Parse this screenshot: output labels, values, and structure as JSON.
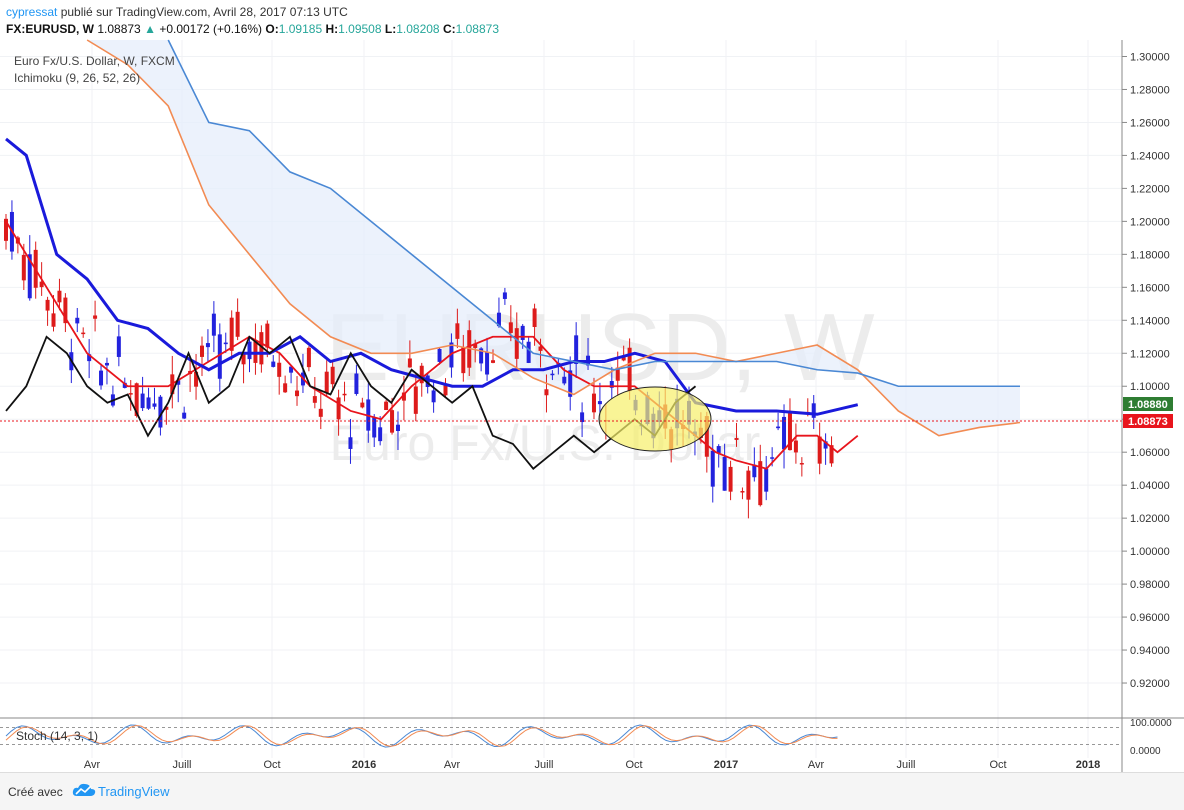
{
  "header": {
    "user": "cypressat",
    "published_text": "publié sur TradingView.com, Avril 28, 2017 07:13 UTC",
    "symbol": "FX:EURUSD, W",
    "price": "1.08873",
    "change": "+0.00172 (+0.16%)",
    "o_label": "O:",
    "o_value": "1.09185",
    "h_label": "H:",
    "h_value": "1.09508",
    "l_label": "L:",
    "l_value": "1.08208",
    "c_label": "C:",
    "c_value": "1.08873"
  },
  "legend": {
    "title": "Euro Fx/U.S. Dollar, W, FXCM",
    "indicator": "Ichimoku (9, 26, 52, 26)",
    "stoch": "Stoch (14, 3, 1)"
  },
  "watermark": {
    "line1": "EURUSD, W",
    "line2": "Euro Fx/U.S. Dollar"
  },
  "footer": {
    "created_with": "Créé avec",
    "brand": "TradingView"
  },
  "colors": {
    "tenkan": "#e8141c",
    "kijun": "#1a1adb",
    "chikou": "#111111",
    "senkou_a": "#f28b53",
    "senkou_b": "#4a88d4",
    "cloud": "#e6eefb",
    "up_candle": "#2222dd",
    "down_candle": "#dd1b1b",
    "price_tag": "#e8141c",
    "kijun_tag": "#2e7d32"
  },
  "chart_data": {
    "type": "candlestick",
    "y_axis": {
      "range": [
        0.9,
        1.31
      ],
      "ticks": [
        "1.30000",
        "1.28000",
        "1.26000",
        "1.24000",
        "1.22000",
        "1.20000",
        "1.18000",
        "1.16000",
        "1.14000",
        "1.12000",
        "1.10000",
        "1.08000",
        "1.06000",
        "1.04000",
        "1.02000",
        "1.00000",
        "0.98000",
        "0.96000",
        "0.94000",
        "0.92000"
      ]
    },
    "x_axis": {
      "labels": [
        "Avr",
        "Juill",
        "Oct",
        "2016",
        "Avr",
        "Juill",
        "Oct",
        "2017",
        "Avr",
        "Juill",
        "Oct",
        "2018"
      ]
    },
    "last_price": "1.08873",
    "kijun_value": "1.08880",
    "annotations": [
      "yellow ellipse around Oct 2016 cloud crossing"
    ],
    "series": [
      {
        "name": "Tenkan",
        "points": [
          [
            0,
            1.2
          ],
          [
            0.04,
            1.16
          ],
          [
            0.08,
            1.12
          ],
          [
            0.12,
            1.1
          ],
          [
            0.16,
            1.1
          ],
          [
            0.2,
            1.115
          ],
          [
            0.24,
            1.13
          ],
          [
            0.27,
            1.12
          ],
          [
            0.3,
            1.1
          ],
          [
            0.34,
            1.085
          ],
          [
            0.37,
            1.08
          ],
          [
            0.4,
            1.1
          ],
          [
            0.44,
            1.12
          ],
          [
            0.48,
            1.13
          ],
          [
            0.52,
            1.13
          ],
          [
            0.55,
            1.11
          ],
          [
            0.58,
            1.1
          ],
          [
            0.6,
            1.1
          ],
          [
            0.62,
            1.1
          ],
          [
            0.64,
            1.09
          ],
          [
            0.67,
            1.075
          ],
          [
            0.7,
            1.06
          ],
          [
            0.72,
            1.055
          ],
          [
            0.75,
            1.05
          ],
          [
            0.78,
            1.07
          ],
          [
            0.8,
            1.07
          ],
          [
            0.82,
            1.06
          ],
          [
            0.84,
            1.07
          ]
        ]
      },
      {
        "name": "Kijun",
        "points": [
          [
            0,
            1.25
          ],
          [
            0.02,
            1.24
          ],
          [
            0.05,
            1.18
          ],
          [
            0.08,
            1.165
          ],
          [
            0.11,
            1.14
          ],
          [
            0.14,
            1.135
          ],
          [
            0.17,
            1.12
          ],
          [
            0.2,
            1.11
          ],
          [
            0.23,
            1.12
          ],
          [
            0.26,
            1.12
          ],
          [
            0.29,
            1.13
          ],
          [
            0.32,
            1.115
          ],
          [
            0.35,
            1.12
          ],
          [
            0.38,
            1.11
          ],
          [
            0.41,
            1.105
          ],
          [
            0.44,
            1.1
          ],
          [
            0.47,
            1.1
          ],
          [
            0.5,
            1.11
          ],
          [
            0.53,
            1.11
          ],
          [
            0.56,
            1.115
          ],
          [
            0.59,
            1.115
          ],
          [
            0.62,
            1.12
          ],
          [
            0.65,
            1.115
          ],
          [
            0.68,
            1.09
          ],
          [
            0.72,
            1.085
          ],
          [
            0.76,
            1.085
          ],
          [
            0.8,
            1.083
          ],
          [
            0.84,
            1.0888
          ]
        ]
      },
      {
        "name": "Chikou",
        "points": [
          [
            0,
            1.085
          ],
          [
            0.02,
            1.1
          ],
          [
            0.04,
            1.13
          ],
          [
            0.06,
            1.12
          ],
          [
            0.08,
            1.1
          ],
          [
            0.1,
            1.09
          ],
          [
            0.12,
            1.095
          ],
          [
            0.14,
            1.07
          ],
          [
            0.16,
            1.09
          ],
          [
            0.18,
            1.12
          ],
          [
            0.2,
            1.09
          ],
          [
            0.22,
            1.1
          ],
          [
            0.24,
            1.13
          ],
          [
            0.26,
            1.12
          ],
          [
            0.28,
            1.13
          ],
          [
            0.3,
            1.1
          ],
          [
            0.32,
            1.095
          ],
          [
            0.34,
            1.12
          ],
          [
            0.36,
            1.1
          ],
          [
            0.38,
            1.09
          ],
          [
            0.4,
            1.11
          ],
          [
            0.42,
            1.1
          ],
          [
            0.44,
            1.09
          ],
          [
            0.46,
            1.1
          ],
          [
            0.48,
            1.07
          ],
          [
            0.5,
            1.065
          ],
          [
            0.52,
            1.05
          ],
          [
            0.54,
            1.06
          ],
          [
            0.56,
            1.07
          ],
          [
            0.58,
            1.06
          ],
          [
            0.6,
            1.07
          ],
          [
            0.62,
            1.08
          ],
          [
            0.64,
            1.07
          ],
          [
            0.66,
            1.09
          ],
          [
            0.68,
            1.1
          ]
        ]
      },
      {
        "name": "Senkou A",
        "points": [
          [
            0.08,
            1.31
          ],
          [
            0.12,
            1.295
          ],
          [
            0.16,
            1.27
          ],
          [
            0.2,
            1.21
          ],
          [
            0.24,
            1.18
          ],
          [
            0.28,
            1.15
          ],
          [
            0.32,
            1.13
          ],
          [
            0.36,
            1.12
          ],
          [
            0.4,
            1.12
          ],
          [
            0.44,
            1.125
          ],
          [
            0.48,
            1.12
          ],
          [
            0.52,
            1.105
          ],
          [
            0.56,
            1.095
          ],
          [
            0.6,
            1.11
          ],
          [
            0.64,
            1.12
          ],
          [
            0.68,
            1.12
          ],
          [
            0.72,
            1.115
          ],
          [
            0.76,
            1.12
          ],
          [
            0.8,
            1.125
          ],
          [
            0.84,
            1.11
          ],
          [
            0.88,
            1.085
          ],
          [
            0.92,
            1.07
          ],
          [
            0.96,
            1.075
          ],
          [
            1.0,
            1.078
          ]
        ]
      },
      {
        "name": "Senkou B",
        "points": [
          [
            0.16,
            1.31
          ],
          [
            0.2,
            1.26
          ],
          [
            0.24,
            1.255
          ],
          [
            0.28,
            1.23
          ],
          [
            0.32,
            1.22
          ],
          [
            0.36,
            1.2
          ],
          [
            0.4,
            1.18
          ],
          [
            0.44,
            1.16
          ],
          [
            0.48,
            1.14
          ],
          [
            0.52,
            1.12
          ],
          [
            0.56,
            1.115
          ],
          [
            0.6,
            1.11
          ],
          [
            0.64,
            1.115
          ],
          [
            0.68,
            1.115
          ],
          [
            0.72,
            1.115
          ],
          [
            0.76,
            1.115
          ],
          [
            0.8,
            1.11
          ],
          [
            0.84,
            1.108
          ],
          [
            0.88,
            1.1
          ],
          [
            0.92,
            1.1
          ],
          [
            0.96,
            1.1
          ],
          [
            1.0,
            1.1
          ]
        ]
      }
    ],
    "stochastic": {
      "name": "Stoch (14, 3, 1)",
      "range": [
        0,
        100
      ],
      "ticks": [
        "100.0000",
        "0.0000"
      ],
      "levels": [
        80,
        20
      ]
    }
  }
}
